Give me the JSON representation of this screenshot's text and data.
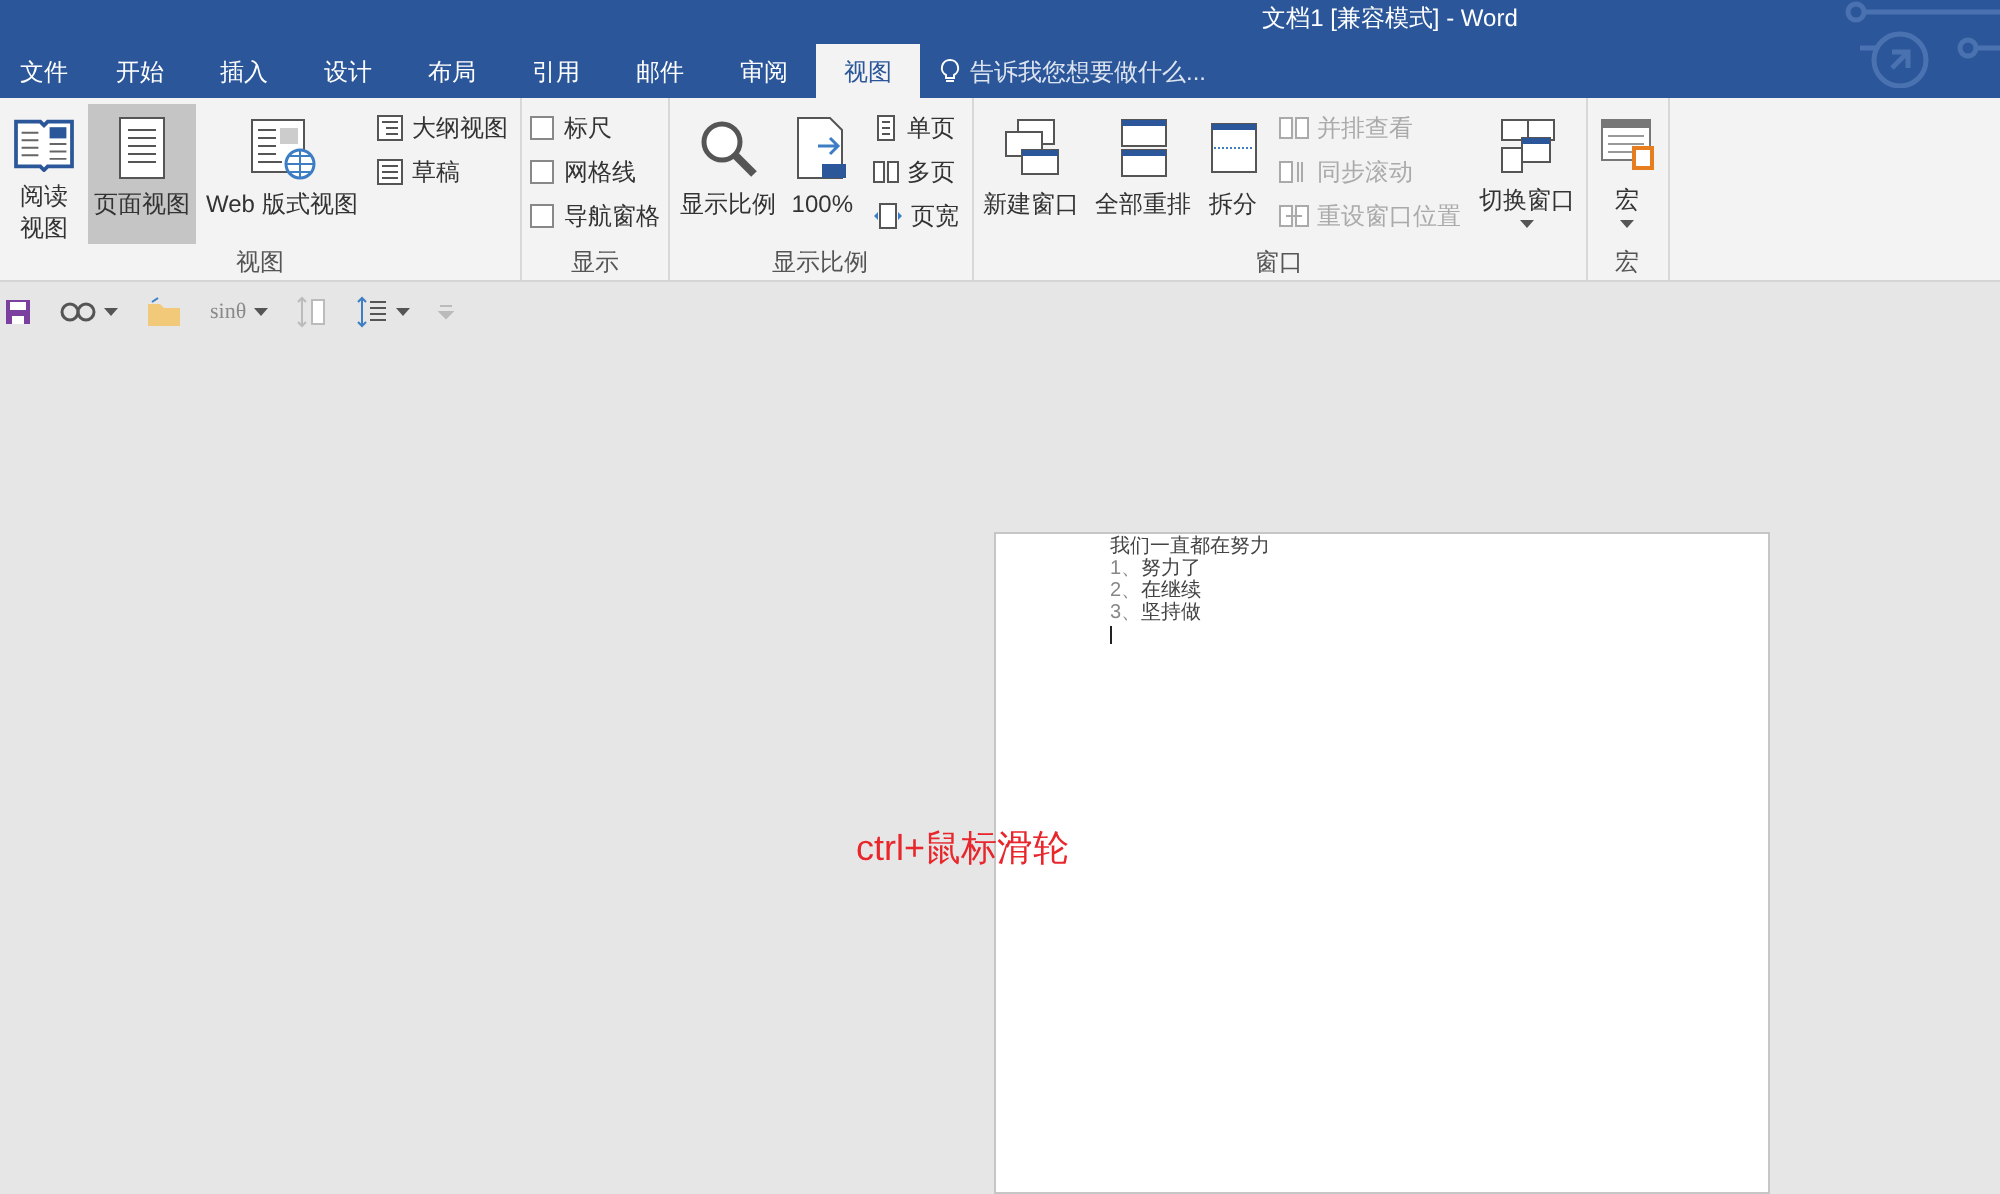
{
  "window": {
    "title": "文档1 [兼容模式] - Word"
  },
  "tabs": [
    {
      "label": "文件",
      "selected": false
    },
    {
      "label": "开始",
      "selected": false
    },
    {
      "label": "插入",
      "selected": false
    },
    {
      "label": "设计",
      "selected": false
    },
    {
      "label": "布局",
      "selected": false
    },
    {
      "label": "引用",
      "selected": false
    },
    {
      "label": "邮件",
      "selected": false
    },
    {
      "label": "审阅",
      "selected": false
    },
    {
      "label": "视图",
      "selected": true
    }
  ],
  "tell_me": {
    "placeholder": "告诉我您想要做什么..."
  },
  "ribbon": [
    {
      "label": "视图",
      "columns": [
        [
          {
            "kind": "large",
            "label": "阅读视图",
            "selected": false
          }
        ],
        [
          {
            "kind": "large",
            "label": "页面视图",
            "selected": true
          }
        ],
        [
          {
            "kind": "large",
            "label": "Web 版式视图",
            "selected": false
          }
        ],
        [
          {
            "kind": "small",
            "label": "大纲视图",
            "disabled": false
          },
          {
            "kind": "small",
            "label": "草稿",
            "disabled": false
          }
        ]
      ]
    },
    {
      "label": "显示",
      "columns": [
        [
          {
            "kind": "checkbox",
            "label": "标尺",
            "checked": false
          },
          {
            "kind": "checkbox",
            "label": "网格线",
            "checked": false
          },
          {
            "kind": "checkbox",
            "label": "导航窗格",
            "checked": false
          }
        ]
      ]
    },
    {
      "label": "显示比例",
      "columns": [
        [
          {
            "kind": "large",
            "label": "显示比例",
            "selected": false
          }
        ],
        [
          {
            "kind": "large",
            "label": "100%",
            "selected": false
          }
        ],
        [
          {
            "kind": "small",
            "label": "单页",
            "disabled": false
          },
          {
            "kind": "small",
            "label": "多页",
            "disabled": false
          },
          {
            "kind": "small",
            "label": "页宽",
            "disabled": false
          }
        ]
      ]
    },
    {
      "label": "窗口",
      "columns": [
        [
          {
            "kind": "large",
            "label": "新建窗口",
            "selected": false
          }
        ],
        [
          {
            "kind": "large",
            "label": "全部重排",
            "selected": false
          }
        ],
        [
          {
            "kind": "large",
            "label": "拆分",
            "selected": false
          }
        ],
        [
          {
            "kind": "small",
            "label": "并排查看",
            "disabled": true
          },
          {
            "kind": "small",
            "label": "同步滚动",
            "disabled": true
          },
          {
            "kind": "small",
            "label": "重设窗口位置",
            "disabled": true
          }
        ],
        [
          {
            "kind": "large",
            "label": "切换窗口",
            "selected": false,
            "dropdown": true
          }
        ]
      ]
    },
    {
      "label": "宏",
      "columns": [
        [
          {
            "kind": "large",
            "label": "宏",
            "selected": false,
            "dropdown": true
          }
        ]
      ]
    }
  ],
  "quick_toolbar": [
    {
      "kind": "save"
    },
    {
      "kind": "glasses",
      "dropdown": true
    },
    {
      "kind": "folder"
    },
    {
      "kind": "text",
      "label": "sinθ",
      "disabled": true,
      "dropdown": true
    },
    {
      "kind": "spacing",
      "disabled": true
    },
    {
      "kind": "linespacing",
      "dropdown": true
    },
    {
      "kind": "more",
      "disabled": true
    }
  ],
  "document": {
    "heading": "我们一直都在努力",
    "list": [
      {
        "number": "1、",
        "text": "努力了"
      },
      {
        "number": "2、",
        "text": "在继续"
      },
      {
        "number": "3、",
        "text": "坚持做"
      }
    ]
  },
  "annotation": "ctrl+鼠标滑轮"
}
